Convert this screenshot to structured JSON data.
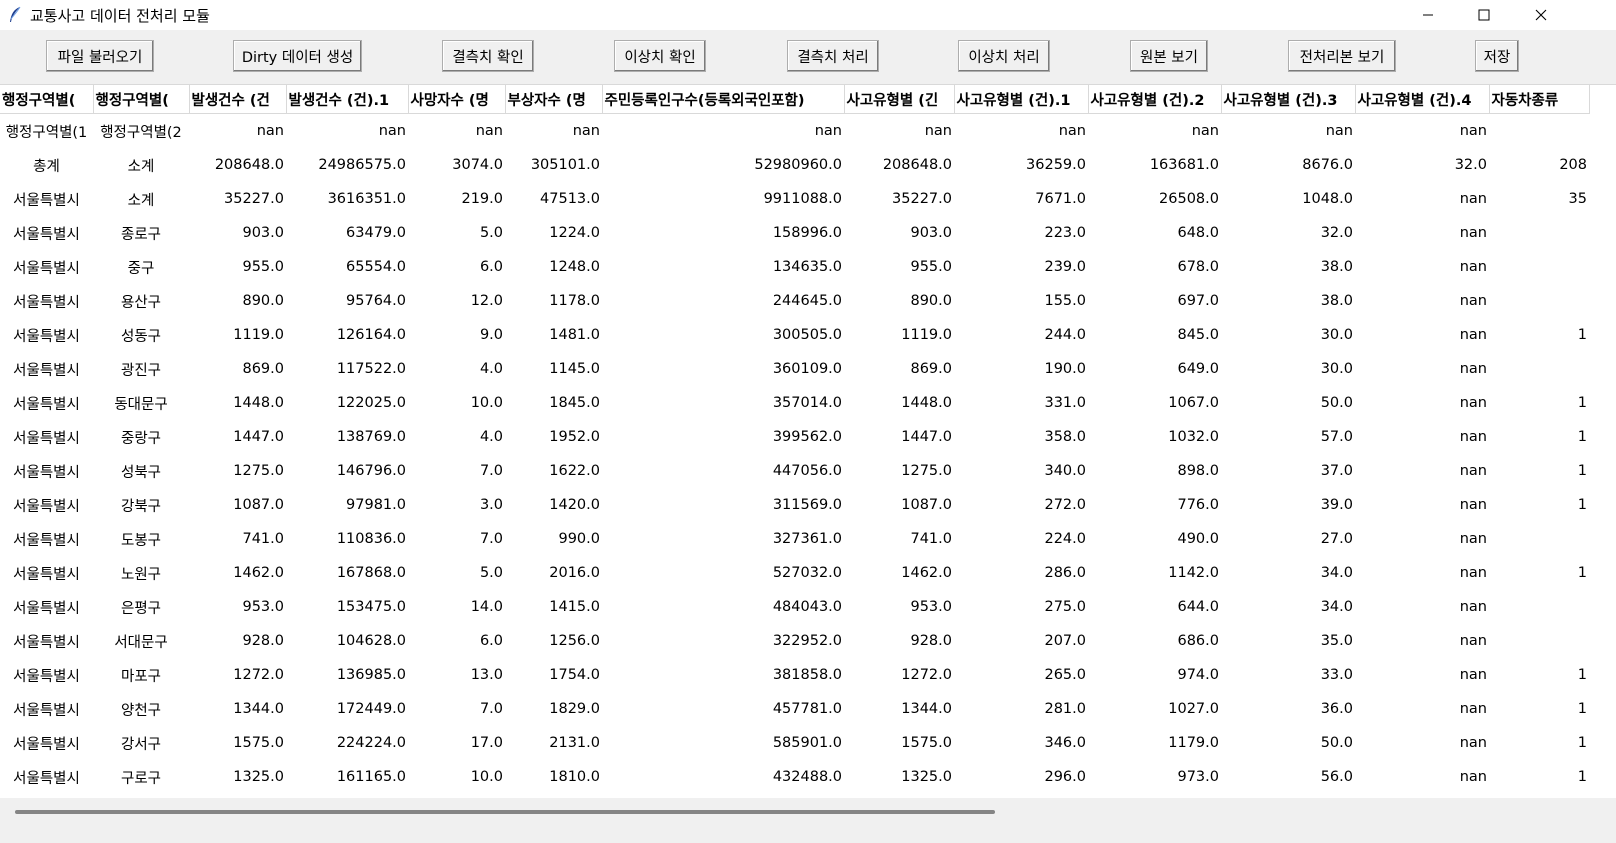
{
  "window": {
    "title": "교통사고 데이터 전처리 모듈"
  },
  "toolbar": {
    "buttons": [
      "파일 불러오기",
      "Dirty 데이터 생성",
      "결측치 확인",
      "이상치 확인",
      "결측치 처리",
      "이상치 처리",
      "원본 보기",
      "전처리본 보기",
      "저장"
    ]
  },
  "table": {
    "headers": [
      "행정구역별(",
      "행정구역별(",
      "발생건수 (건",
      "발생건수 (건).1",
      "사망자수 (명",
      "부상자수 (명",
      "주민등록인구수(등록외국인포함)",
      "사고유형별 (긴",
      "사고유형별 (건).1",
      "사고유형별 (건).2",
      "사고유형별 (건).3",
      "사고유형별 (건).4",
      "자동차종류"
    ],
    "rows": [
      [
        "행정구역별(1",
        "행정구역별(2",
        "nan",
        "nan",
        "nan",
        "nan",
        "nan",
        "nan",
        "nan",
        "nan",
        "nan",
        "nan",
        ""
      ],
      [
        "총계",
        "소계",
        "208648.0",
        "24986575.0",
        "3074.0",
        "305101.0",
        "52980960.0",
        "208648.0",
        "36259.0",
        "163681.0",
        "8676.0",
        "32.0",
        "208"
      ],
      [
        "서울특별시",
        "소계",
        "35227.0",
        "3616351.0",
        "219.0",
        "47513.0",
        "9911088.0",
        "35227.0",
        "7671.0",
        "26508.0",
        "1048.0",
        "nan",
        "35"
      ],
      [
        "서울특별시",
        "종로구",
        "903.0",
        "63479.0",
        "5.0",
        "1224.0",
        "158996.0",
        "903.0",
        "223.0",
        "648.0",
        "32.0",
        "nan",
        ""
      ],
      [
        "서울특별시",
        "중구",
        "955.0",
        "65554.0",
        "6.0",
        "1248.0",
        "134635.0",
        "955.0",
        "239.0",
        "678.0",
        "38.0",
        "nan",
        ""
      ],
      [
        "서울특별시",
        "용산구",
        "890.0",
        "95764.0",
        "12.0",
        "1178.0",
        "244645.0",
        "890.0",
        "155.0",
        "697.0",
        "38.0",
        "nan",
        ""
      ],
      [
        "서울특별시",
        "성동구",
        "1119.0",
        "126164.0",
        "9.0",
        "1481.0",
        "300505.0",
        "1119.0",
        "244.0",
        "845.0",
        "30.0",
        "nan",
        "1"
      ],
      [
        "서울특별시",
        "광진구",
        "869.0",
        "117522.0",
        "4.0",
        "1145.0",
        "360109.0",
        "869.0",
        "190.0",
        "649.0",
        "30.0",
        "nan",
        ""
      ],
      [
        "서울특별시",
        "동대문구",
        "1448.0",
        "122025.0",
        "10.0",
        "1845.0",
        "357014.0",
        "1448.0",
        "331.0",
        "1067.0",
        "50.0",
        "nan",
        "1"
      ],
      [
        "서울특별시",
        "중랑구",
        "1447.0",
        "138769.0",
        "4.0",
        "1952.0",
        "399562.0",
        "1447.0",
        "358.0",
        "1032.0",
        "57.0",
        "nan",
        "1"
      ],
      [
        "서울특별시",
        "성북구",
        "1275.0",
        "146796.0",
        "7.0",
        "1622.0",
        "447056.0",
        "1275.0",
        "340.0",
        "898.0",
        "37.0",
        "nan",
        "1"
      ],
      [
        "서울특별시",
        "강북구",
        "1087.0",
        "97981.0",
        "3.0",
        "1420.0",
        "311569.0",
        "1087.0",
        "272.0",
        "776.0",
        "39.0",
        "nan",
        "1"
      ],
      [
        "서울특별시",
        "도봉구",
        "741.0",
        "110836.0",
        "7.0",
        "990.0",
        "327361.0",
        "741.0",
        "224.0",
        "490.0",
        "27.0",
        "nan",
        ""
      ],
      [
        "서울특별시",
        "노원구",
        "1462.0",
        "167868.0",
        "5.0",
        "2016.0",
        "527032.0",
        "1462.0",
        "286.0",
        "1142.0",
        "34.0",
        "nan",
        "1"
      ],
      [
        "서울특별시",
        "은평구",
        "953.0",
        "153475.0",
        "14.0",
        "1415.0",
        "484043.0",
        "953.0",
        "275.0",
        "644.0",
        "34.0",
        "nan",
        ""
      ],
      [
        "서울특별시",
        "서대문구",
        "928.0",
        "104628.0",
        "6.0",
        "1256.0",
        "322952.0",
        "928.0",
        "207.0",
        "686.0",
        "35.0",
        "nan",
        ""
      ],
      [
        "서울특별시",
        "마포구",
        "1272.0",
        "136985.0",
        "13.0",
        "1754.0",
        "381858.0",
        "1272.0",
        "265.0",
        "974.0",
        "33.0",
        "nan",
        "1"
      ],
      [
        "서울특별시",
        "양천구",
        "1344.0",
        "172449.0",
        "7.0",
        "1829.0",
        "457781.0",
        "1344.0",
        "281.0",
        "1027.0",
        "36.0",
        "nan",
        "1"
      ],
      [
        "서울특별시",
        "강서구",
        "1575.0",
        "224224.0",
        "17.0",
        "2131.0",
        "585901.0",
        "1575.0",
        "346.0",
        "1179.0",
        "50.0",
        "nan",
        "1"
      ],
      [
        "서울특별시",
        "구로구",
        "1325.0",
        "161165.0",
        "10.0",
        "1810.0",
        "432488.0",
        "1325.0",
        "296.0",
        "973.0",
        "56.0",
        "nan",
        "1"
      ]
    ]
  }
}
